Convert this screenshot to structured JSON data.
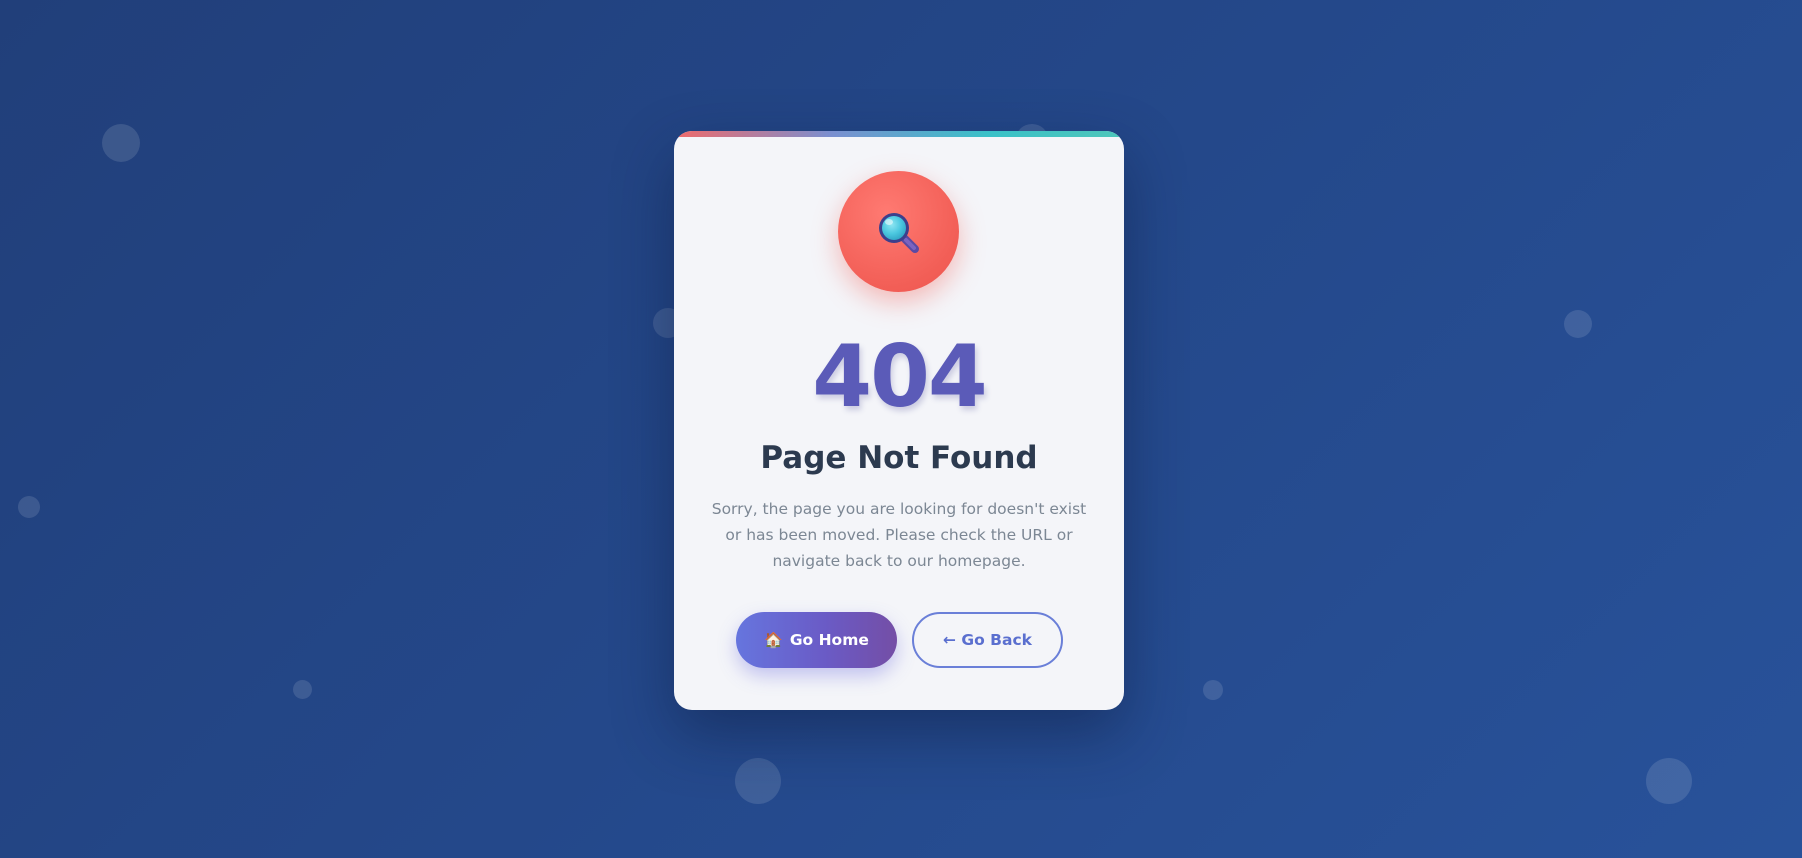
{
  "error": {
    "code": "404",
    "title": "Page Not Found",
    "message": "Sorry, the page you are looking for doesn't exist or has been moved. Please check the URL or navigate back to our homepage.",
    "icon": "magnifier-icon"
  },
  "actions": {
    "home": {
      "icon": "🏠",
      "label": "Go Home"
    },
    "back": {
      "label": "← Go Back"
    }
  },
  "colors": {
    "background": "#24488a",
    "card": "#f4f5f9",
    "icon_circle": "#f25e56",
    "code": "#5b5bb8",
    "title": "#2c3a4f",
    "message": "#7c8794",
    "primary_button_start": "#6675de",
    "primary_button_end": "#744ea6",
    "secondary_button": "#6a7fd8"
  }
}
